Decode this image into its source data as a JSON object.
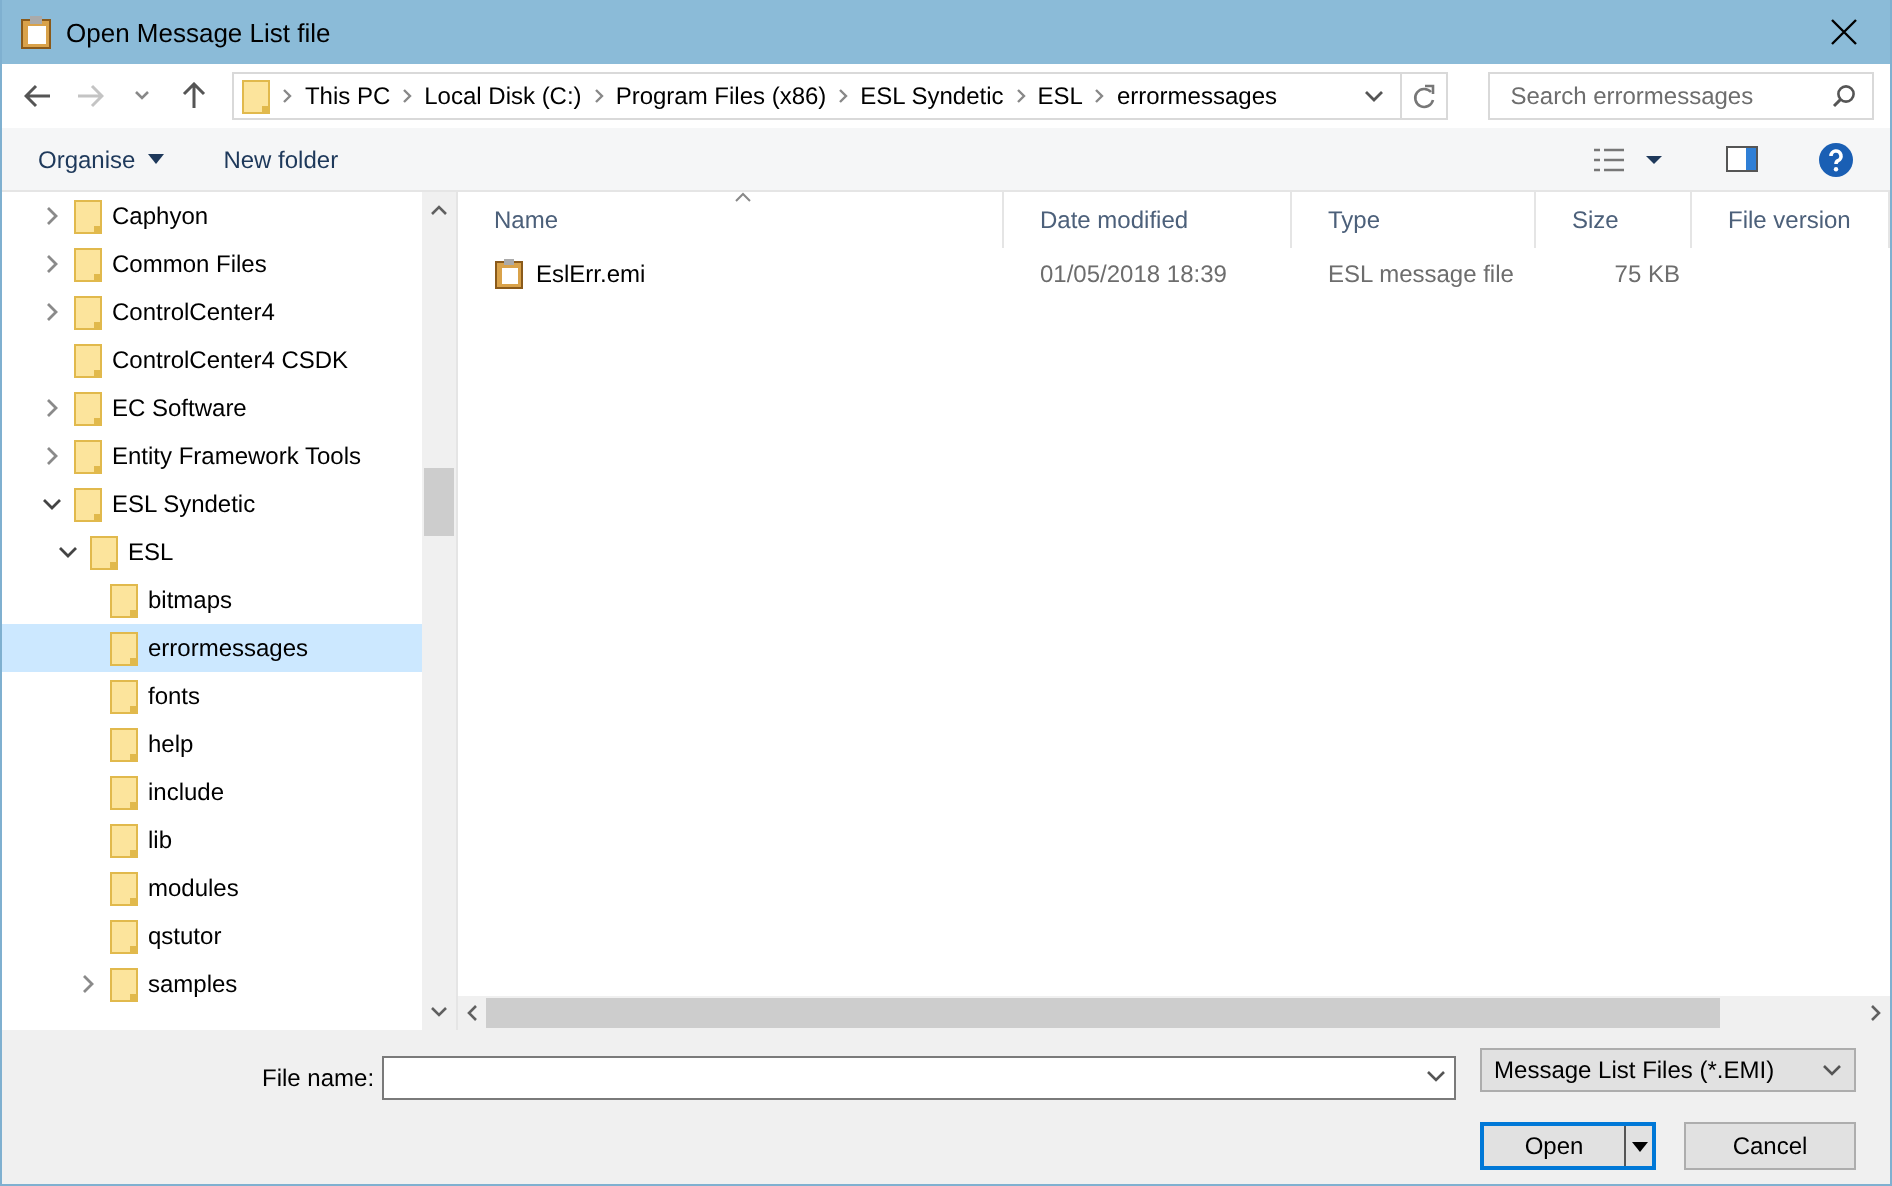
{
  "window": {
    "title": "Open Message List file"
  },
  "breadcrumb": [
    "This PC",
    "Local Disk (C:)",
    "Program Files (x86)",
    "ESL Syndetic",
    "ESL",
    "errormessages"
  ],
  "search": {
    "placeholder": "Search errormessages"
  },
  "toolbar": {
    "organise": "Organise",
    "new_folder": "New folder"
  },
  "tree": [
    {
      "label": "Caphyon",
      "has_children": true,
      "expanded": false,
      "selected": false
    },
    {
      "label": "Common Files",
      "has_children": true,
      "expanded": false,
      "selected": false
    },
    {
      "label": "ControlCenter4",
      "has_children": true,
      "expanded": false,
      "selected": false
    },
    {
      "label": "ControlCenter4 CSDK",
      "has_children": false,
      "expanded": false,
      "selected": false
    },
    {
      "label": "EC Software",
      "has_children": true,
      "expanded": false,
      "selected": false
    },
    {
      "label": "Entity Framework Tools",
      "has_children": true,
      "expanded": false,
      "selected": false
    },
    {
      "label": "ESL Syndetic",
      "expanded": true,
      "selected": false,
      "children": [
        {
          "label": "ESL",
          "expanded": true,
          "selected": false,
          "children": [
            {
              "label": "bitmaps",
              "has_children": false,
              "expanded": false,
              "selected": false
            },
            {
              "label": "errormessages",
              "has_children": false,
              "expanded": false,
              "selected": true
            },
            {
              "label": "fonts",
              "has_children": false,
              "expanded": false,
              "selected": false
            },
            {
              "label": "help",
              "has_children": false,
              "expanded": false,
              "selected": false
            },
            {
              "label": "include",
              "has_children": false,
              "expanded": false,
              "selected": false
            },
            {
              "label": "lib",
              "has_children": false,
              "expanded": false,
              "selected": false
            },
            {
              "label": "modules",
              "has_children": false,
              "expanded": false,
              "selected": false
            },
            {
              "label": "qstutor",
              "has_children": false,
              "expanded": false,
              "selected": false
            },
            {
              "label": "samples",
              "has_children": true,
              "expanded": false,
              "selected": false
            }
          ]
        }
      ]
    }
  ],
  "table": {
    "columns": [
      "Name",
      "Date modified",
      "Type",
      "Size",
      "File version"
    ],
    "rows": [
      {
        "name": "EslErr.emi",
        "date": "01/05/2018 18:39",
        "type": "ESL message file",
        "size": "75 KB"
      }
    ]
  },
  "file_name": {
    "label": "File name:"
  },
  "filter": "Message List Files (*.EMI)",
  "buttons": {
    "open": "Open",
    "cancel": "Cancel"
  }
}
